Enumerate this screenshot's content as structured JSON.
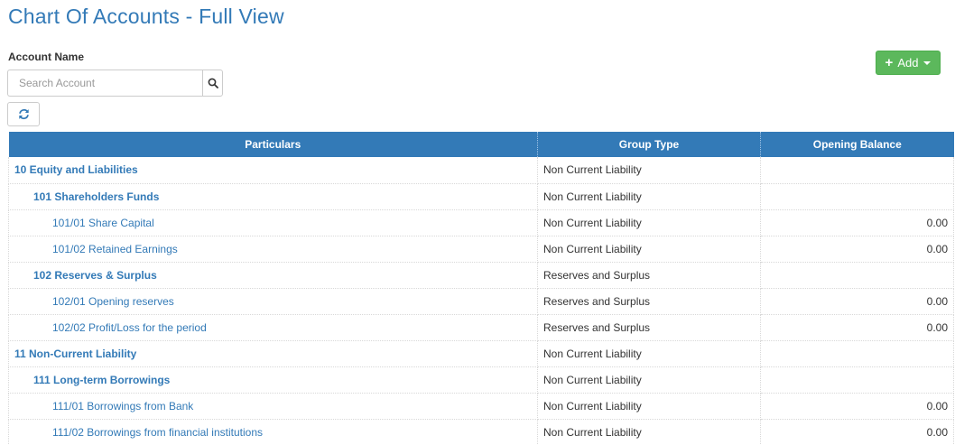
{
  "page": {
    "title": "Chart Of Accounts - Full View"
  },
  "filter": {
    "label": "Account Name",
    "search_placeholder": "Search Account",
    "search_value": ""
  },
  "toolbar": {
    "add_label": "Add"
  },
  "table": {
    "headers": [
      "Particulars",
      "Group Type",
      "Opening Balance"
    ],
    "rows": [
      {
        "level": 1,
        "particular": "10 Equity and Liabilities",
        "group_type": "Non Current Liability",
        "balance": ""
      },
      {
        "level": 2,
        "particular": "101 Shareholders Funds",
        "group_type": "Non Current Liability",
        "balance": ""
      },
      {
        "level": 3,
        "particular": "101/01 Share Capital",
        "group_type": "Non Current Liability",
        "balance": "0.00"
      },
      {
        "level": 3,
        "particular": "101/02 Retained Earnings",
        "group_type": "Non Current Liability",
        "balance": "0.00"
      },
      {
        "level": 2,
        "particular": "102 Reserves & Surplus",
        "group_type": "Reserves and Surplus",
        "balance": ""
      },
      {
        "level": 3,
        "particular": "102/01 Opening reserves",
        "group_type": "Reserves and Surplus",
        "balance": "0.00"
      },
      {
        "level": 3,
        "particular": "102/02 Profit/Loss for the period",
        "group_type": "Reserves and Surplus",
        "balance": "0.00"
      },
      {
        "level": 1,
        "particular": "11 Non-Current Liability",
        "group_type": "Non Current Liability",
        "balance": ""
      },
      {
        "level": 2,
        "particular": "111 Long-term Borrowings",
        "group_type": "Non Current Liability",
        "balance": ""
      },
      {
        "level": 3,
        "particular": "111/01 Borrowings from Bank",
        "group_type": "Non Current Liability",
        "balance": "0.00"
      },
      {
        "level": 3,
        "particular": "111/02 Borrowings from financial institutions",
        "group_type": "Non Current Liability",
        "balance": "0.00"
      }
    ]
  },
  "icons": {
    "search": "search-icon",
    "refresh": "refresh-icon",
    "add": "plus-icon",
    "dropdown": "caret-down-icon"
  },
  "colors": {
    "primary": "#337ab7",
    "success": "#5cb85c",
    "header_text": "#ffffff"
  }
}
